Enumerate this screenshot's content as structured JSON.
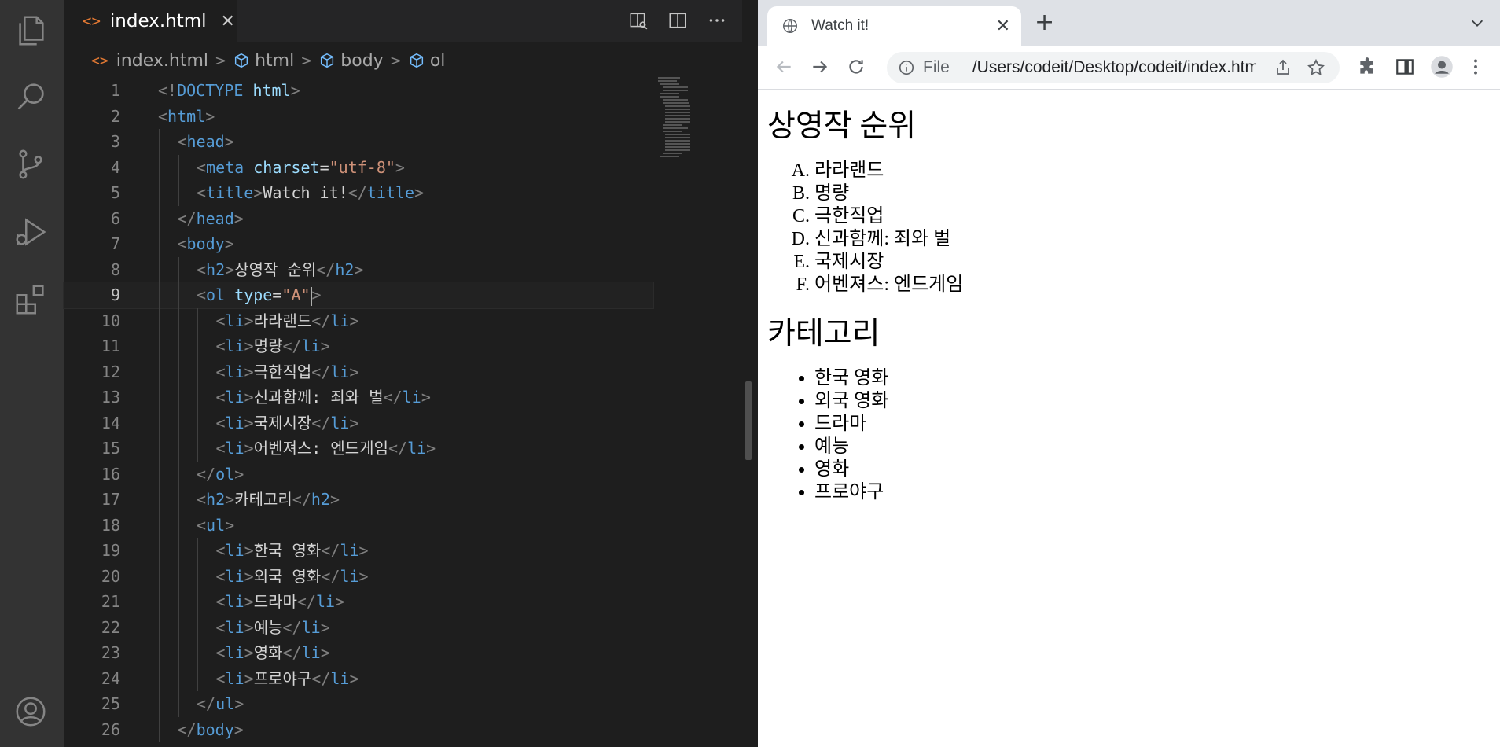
{
  "editor": {
    "tab": {
      "icon": "<>",
      "filename": "index.html"
    },
    "breadcrumb": [
      "index.html",
      "html",
      "body",
      "ol"
    ],
    "current_line": 9,
    "lines": [
      {
        "n": "1",
        "indent": 0,
        "tokens": [
          [
            "br",
            "<!"
          ],
          [
            "tag",
            "DOCTYPE"
          ],
          [
            "txt",
            " "
          ],
          [
            "attr",
            "html"
          ],
          [
            "br",
            ">"
          ]
        ]
      },
      {
        "n": "2",
        "indent": 0,
        "tokens": [
          [
            "br",
            "<"
          ],
          [
            "tag",
            "html"
          ],
          [
            "br",
            ">"
          ]
        ]
      },
      {
        "n": "3",
        "indent": 1,
        "tokens": [
          [
            "br",
            "<"
          ],
          [
            "tag",
            "head"
          ],
          [
            "br",
            ">"
          ]
        ]
      },
      {
        "n": "4",
        "indent": 2,
        "tokens": [
          [
            "br",
            "<"
          ],
          [
            "tag",
            "meta"
          ],
          [
            "txt",
            " "
          ],
          [
            "attr",
            "charset"
          ],
          [
            "txt",
            "="
          ],
          [
            "str",
            "\"utf-8\""
          ],
          [
            "br",
            ">"
          ]
        ]
      },
      {
        "n": "5",
        "indent": 2,
        "tokens": [
          [
            "br",
            "<"
          ],
          [
            "tag",
            "title"
          ],
          [
            "br",
            ">"
          ],
          [
            "txt",
            "Watch it!"
          ],
          [
            "br",
            "</"
          ],
          [
            "tag",
            "title"
          ],
          [
            "br",
            ">"
          ]
        ]
      },
      {
        "n": "6",
        "indent": 1,
        "tokens": [
          [
            "br",
            "</"
          ],
          [
            "tag",
            "head"
          ],
          [
            "br",
            ">"
          ]
        ]
      },
      {
        "n": "7",
        "indent": 1,
        "tokens": [
          [
            "br",
            "<"
          ],
          [
            "tag",
            "body"
          ],
          [
            "br",
            ">"
          ]
        ]
      },
      {
        "n": "8",
        "indent": 2,
        "tokens": [
          [
            "br",
            "<"
          ],
          [
            "tag",
            "h2"
          ],
          [
            "br",
            ">"
          ],
          [
            "txt",
            "상영작 순위"
          ],
          [
            "br",
            "</"
          ],
          [
            "tag",
            "h2"
          ],
          [
            "br",
            ">"
          ]
        ]
      },
      {
        "n": "9",
        "indent": 2,
        "tokens": [
          [
            "br",
            "<"
          ],
          [
            "tag",
            "ol"
          ],
          [
            "txt",
            " "
          ],
          [
            "attr",
            "type"
          ],
          [
            "txt",
            "="
          ],
          [
            "str",
            "\"A\""
          ],
          [
            "cursor",
            ""
          ],
          [
            "br",
            ">"
          ]
        ]
      },
      {
        "n": "10",
        "indent": 3,
        "tokens": [
          [
            "br",
            "<"
          ],
          [
            "tag",
            "li"
          ],
          [
            "br",
            ">"
          ],
          [
            "txt",
            "라라랜드"
          ],
          [
            "br",
            "</"
          ],
          [
            "tag",
            "li"
          ],
          [
            "br",
            ">"
          ]
        ]
      },
      {
        "n": "11",
        "indent": 3,
        "tokens": [
          [
            "br",
            "<"
          ],
          [
            "tag",
            "li"
          ],
          [
            "br",
            ">"
          ],
          [
            "txt",
            "명량"
          ],
          [
            "br",
            "</"
          ],
          [
            "tag",
            "li"
          ],
          [
            "br",
            ">"
          ]
        ]
      },
      {
        "n": "12",
        "indent": 3,
        "tokens": [
          [
            "br",
            "<"
          ],
          [
            "tag",
            "li"
          ],
          [
            "br",
            ">"
          ],
          [
            "txt",
            "극한직업"
          ],
          [
            "br",
            "</"
          ],
          [
            "tag",
            "li"
          ],
          [
            "br",
            ">"
          ]
        ]
      },
      {
        "n": "13",
        "indent": 3,
        "tokens": [
          [
            "br",
            "<"
          ],
          [
            "tag",
            "li"
          ],
          [
            "br",
            ">"
          ],
          [
            "txt",
            "신과함께: 죄와 벌"
          ],
          [
            "br",
            "</"
          ],
          [
            "tag",
            "li"
          ],
          [
            "br",
            ">"
          ]
        ]
      },
      {
        "n": "14",
        "indent": 3,
        "tokens": [
          [
            "br",
            "<"
          ],
          [
            "tag",
            "li"
          ],
          [
            "br",
            ">"
          ],
          [
            "txt",
            "국제시장"
          ],
          [
            "br",
            "</"
          ],
          [
            "tag",
            "li"
          ],
          [
            "br",
            ">"
          ]
        ]
      },
      {
        "n": "15",
        "indent": 3,
        "tokens": [
          [
            "br",
            "<"
          ],
          [
            "tag",
            "li"
          ],
          [
            "br",
            ">"
          ],
          [
            "txt",
            "어벤져스: 엔드게임"
          ],
          [
            "br",
            "</"
          ],
          [
            "tag",
            "li"
          ],
          [
            "br",
            ">"
          ]
        ]
      },
      {
        "n": "16",
        "indent": 2,
        "tokens": [
          [
            "br",
            "</"
          ],
          [
            "tag",
            "ol"
          ],
          [
            "br",
            ">"
          ]
        ]
      },
      {
        "n": "17",
        "indent": 2,
        "tokens": [
          [
            "br",
            "<"
          ],
          [
            "tag",
            "h2"
          ],
          [
            "br",
            ">"
          ],
          [
            "txt",
            "카테고리"
          ],
          [
            "br",
            "</"
          ],
          [
            "tag",
            "h2"
          ],
          [
            "br",
            ">"
          ]
        ]
      },
      {
        "n": "18",
        "indent": 2,
        "tokens": [
          [
            "br",
            "<"
          ],
          [
            "tag",
            "ul"
          ],
          [
            "br",
            ">"
          ]
        ]
      },
      {
        "n": "19",
        "indent": 3,
        "tokens": [
          [
            "br",
            "<"
          ],
          [
            "tag",
            "li"
          ],
          [
            "br",
            ">"
          ],
          [
            "txt",
            "한국 영화"
          ],
          [
            "br",
            "</"
          ],
          [
            "tag",
            "li"
          ],
          [
            "br",
            ">"
          ]
        ]
      },
      {
        "n": "20",
        "indent": 3,
        "tokens": [
          [
            "br",
            "<"
          ],
          [
            "tag",
            "li"
          ],
          [
            "br",
            ">"
          ],
          [
            "txt",
            "외국 영화"
          ],
          [
            "br",
            "</"
          ],
          [
            "tag",
            "li"
          ],
          [
            "br",
            ">"
          ]
        ]
      },
      {
        "n": "21",
        "indent": 3,
        "tokens": [
          [
            "br",
            "<"
          ],
          [
            "tag",
            "li"
          ],
          [
            "br",
            ">"
          ],
          [
            "txt",
            "드라마"
          ],
          [
            "br",
            "</"
          ],
          [
            "tag",
            "li"
          ],
          [
            "br",
            ">"
          ]
        ]
      },
      {
        "n": "22",
        "indent": 3,
        "tokens": [
          [
            "br",
            "<"
          ],
          [
            "tag",
            "li"
          ],
          [
            "br",
            ">"
          ],
          [
            "txt",
            "예능"
          ],
          [
            "br",
            "</"
          ],
          [
            "tag",
            "li"
          ],
          [
            "br",
            ">"
          ]
        ]
      },
      {
        "n": "23",
        "indent": 3,
        "tokens": [
          [
            "br",
            "<"
          ],
          [
            "tag",
            "li"
          ],
          [
            "br",
            ">"
          ],
          [
            "txt",
            "영화"
          ],
          [
            "br",
            "</"
          ],
          [
            "tag",
            "li"
          ],
          [
            "br",
            ">"
          ]
        ]
      },
      {
        "n": "24",
        "indent": 3,
        "tokens": [
          [
            "br",
            "<"
          ],
          [
            "tag",
            "li"
          ],
          [
            "br",
            ">"
          ],
          [
            "txt",
            "프로야구"
          ],
          [
            "br",
            "</"
          ],
          [
            "tag",
            "li"
          ],
          [
            "br",
            ">"
          ]
        ]
      },
      {
        "n": "25",
        "indent": 2,
        "tokens": [
          [
            "br",
            "</"
          ],
          [
            "tag",
            "ul"
          ],
          [
            "br",
            ">"
          ]
        ]
      },
      {
        "n": "26",
        "indent": 1,
        "tokens": [
          [
            "br",
            "</"
          ],
          [
            "tag",
            "body"
          ],
          [
            "br",
            ">"
          ]
        ]
      }
    ]
  },
  "browser": {
    "tab_title": "Watch it!",
    "omnibox": {
      "label": "File",
      "url": "/Users/codeit/Desktop/codeit/index.html"
    },
    "page": {
      "heading1": "상영작 순위",
      "ranking": [
        "라라랜드",
        "명량",
        "극한직업",
        "신과함께: 죄와 벌",
        "국제시장",
        "어벤져스: 엔드게임"
      ],
      "heading2": "카테고리",
      "categories": [
        "한국 영화",
        "외국 영화",
        "드라마",
        "예능",
        "영화",
        "프로야구"
      ]
    }
  },
  "colors": {
    "tag": "#569cd6",
    "attr": "#9cdcfe",
    "string": "#ce9178",
    "bracket": "#808080",
    "text": "#d4d4d4",
    "activity_bar": "#333333",
    "editor_bg": "#1e1e1e"
  }
}
